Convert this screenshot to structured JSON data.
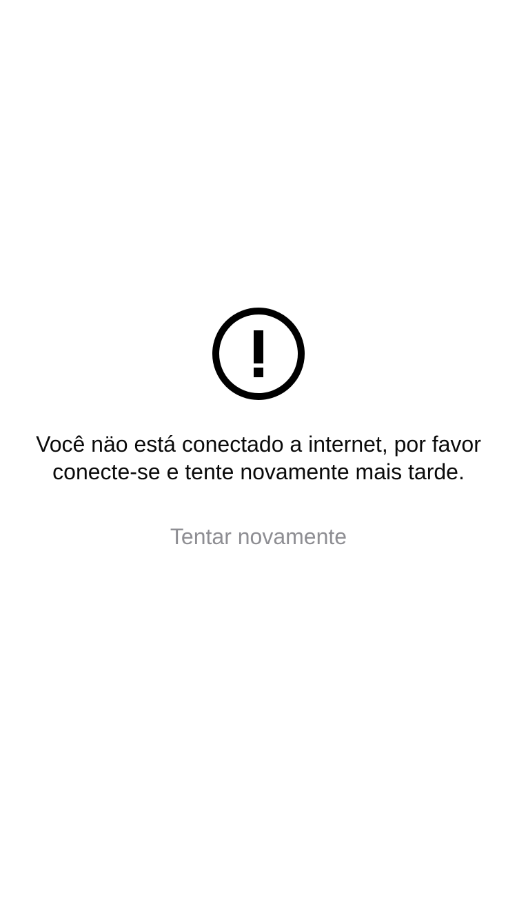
{
  "offline_screen": {
    "icon": "exclamation-circle-icon",
    "message_lines": [
      "Você näo está conectado a internet, por favor",
      "conecte-se e tente novamente mais tarde."
    ],
    "retry_label": "Tentar novamente"
  },
  "colors": {
    "background": "#ffffff",
    "icon": "#000000",
    "message_text": "#0a0a0a",
    "retry_text": "#8e8e93"
  }
}
